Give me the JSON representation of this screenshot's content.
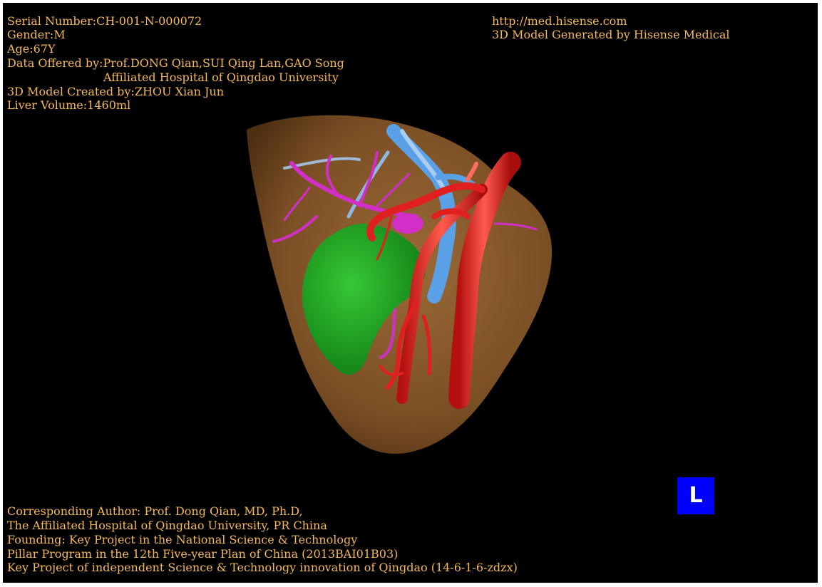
{
  "colors": {
    "background": "#000000",
    "overlay_text": "#f5b95a",
    "liver": "#8a5a2b",
    "gallbladder": "#1fae1f",
    "artery": "#e0201e",
    "portal_vein": "#d22fc8",
    "hepatic_vein": "#5aa0e6",
    "orientation_badge": "#0000ff"
  },
  "header_left": {
    "serial": "Serial Number:CH-001-N-000072",
    "gender": "Gender:M",
    "age": "Age:67Y",
    "data_offered": "Data Offered by:Prof.DONG Qian,SUI Qing Lan,GAO Song",
    "hospital": "Affiliated Hospital of Qingdao University",
    "created_by": "3D Model Created by:ZHOU Xian Jun",
    "liver_volume": "Liver Volume:1460ml"
  },
  "header_right": {
    "url": "http://med.hisense.com",
    "generated_by": "3D Model Generated by Hisense Medical"
  },
  "footer": {
    "line1": "Corresponding Author: Prof. Dong Qian, MD, Ph.D,",
    "line2": "The Affiliated Hospital of Qingdao University, PR China",
    "line3": "Founding: Key Project in the National Science & Technology",
    "line4": "Pillar Program in the 12th Five-year Plan of China (2013BAI01B03)",
    "line5": "Key Project of independent Science & Technology innovation of Qingdao (14-6-1-6-zdzx)"
  },
  "orientation": {
    "label": "L"
  }
}
